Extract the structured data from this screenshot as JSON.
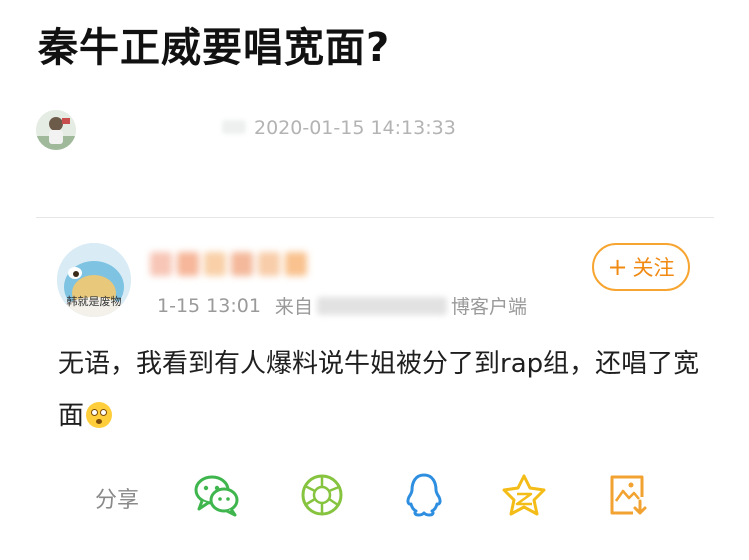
{
  "article": {
    "title": "秦牛正威要唱宽面?",
    "time": "2020-01-15 14:13:33"
  },
  "post": {
    "avatar_caption": "韩就是废物",
    "follow_label": "关注",
    "follow_plus": "+",
    "time": "1-15 13:01",
    "source_prefix": "来自",
    "source_suffix": "博客户端",
    "text": "无语，我看到有人爆料说牛姐被分了到rap组，还唱了宽面"
  },
  "share": {
    "label": "分享",
    "targets": [
      {
        "name": "wechat",
        "icon": "wechat-icon",
        "color": "#3fb64d"
      },
      {
        "name": "moments",
        "icon": "moments-icon",
        "color": "#86c440"
      },
      {
        "name": "qq",
        "icon": "qq-icon",
        "color": "#2e8ee0"
      },
      {
        "name": "qzone",
        "icon": "qzone-icon",
        "color": "#f4bc16"
      },
      {
        "name": "save-image",
        "icon": "save-image-icon",
        "color": "#f2a230"
      }
    ]
  },
  "colors": {
    "accent": "#f08a13",
    "meta_text": "#b3b3b3"
  }
}
